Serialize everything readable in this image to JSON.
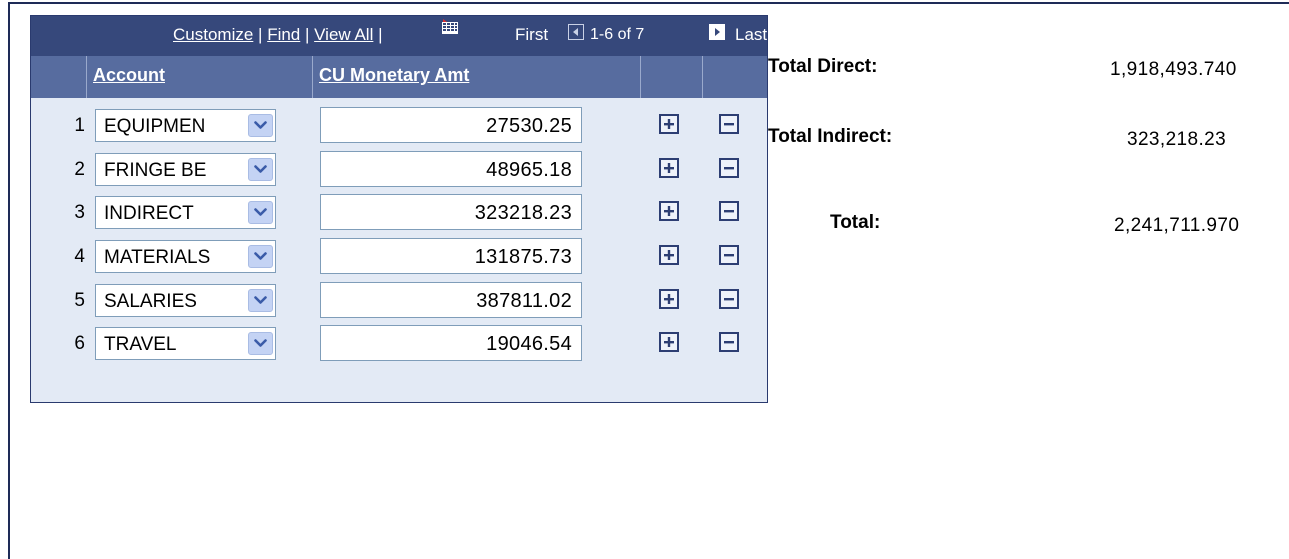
{
  "nav": {
    "customize": "Customize",
    "find": "Find",
    "view_all": "View All",
    "first": "First",
    "range": "1-6 of 7",
    "last": "Last",
    "grid_icon": "download-to-spreadsheet-icon"
  },
  "columns": {
    "account": "Account",
    "amount": "CU Monetary Amt"
  },
  "rows": [
    {
      "num": "1",
      "account": "EQUIPMEN",
      "amount": "27530.25"
    },
    {
      "num": "2",
      "account": "FRINGE BE",
      "amount": "48965.18"
    },
    {
      "num": "3",
      "account": "INDIRECT",
      "amount": "323218.23"
    },
    {
      "num": "4",
      "account": "MATERIALS",
      "amount": "131875.73"
    },
    {
      "num": "5",
      "account": "SALARIES",
      "amount": "387811.02"
    },
    {
      "num": "6",
      "account": "TRAVEL",
      "amount": "19046.54"
    }
  ],
  "summary": {
    "direct_label": "Total Direct:",
    "direct_value": "1,918,493.740",
    "indirect_label": "Total Indirect:",
    "indirect_value": "323,218.23",
    "total_label": "Total:",
    "total_value": "2,241,711.970"
  },
  "colors": {
    "nav_bg": "#36487b",
    "header_bg": "#576c9f",
    "grid_bg": "#e3eaf5"
  }
}
